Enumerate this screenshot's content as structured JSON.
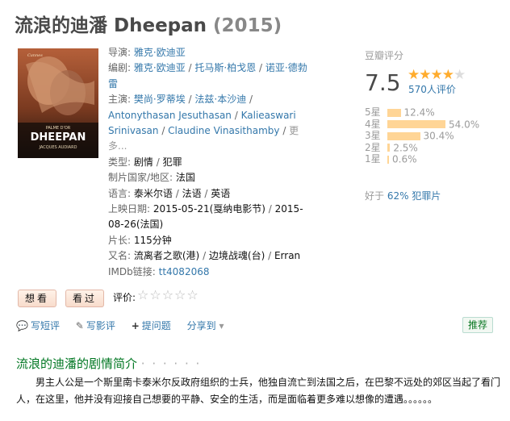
{
  "title": {
    "name": "流浪的迪潘 Dheepan",
    "year": "(2015)"
  },
  "poster": {
    "alt": "Dheepan poster",
    "text_top": "PALME D'OR",
    "text_main": "DHEEPAN",
    "text_dir": "JACQUES AUDIARD",
    "festival": "Cannes",
    "colors": {
      "bg": "#a34e2b",
      "skin": "#c98a64",
      "dark": "#2a1a12"
    }
  },
  "info": {
    "director_label": "导演:",
    "director": "雅克·欧迪亚",
    "writer_label": "编剧:",
    "writers": [
      "雅克·欧迪亚",
      "托马斯·柏戈恩",
      "诺亚·德勃雷"
    ],
    "cast_label": "主演:",
    "cast": [
      "樊尚·罗蒂埃",
      "法兹·本沙迪",
      "Antonythasan Jesuthasan",
      "Kalieaswari Srinivasan",
      "Claudine Vinasithamby"
    ],
    "cast_more": "更多...",
    "genre_label": "类型:",
    "genres": [
      "剧情",
      "犯罪"
    ],
    "country_label": "制片国家/地区:",
    "country": "法国",
    "language_label": "语言:",
    "languages": [
      "泰米尔语",
      "法语",
      "英语"
    ],
    "release_label": "上映日期:",
    "release_1": "2015-05-21(戛纳电影节)",
    "release_2": "2015-08-26(法国)",
    "runtime_label": "片长:",
    "runtime": "115分钟",
    "aka_label": "又名:",
    "aka": [
      "流离者之歌(港)",
      "边境战魂(台)",
      "Erran"
    ],
    "imdb_label": "IMDb链接:",
    "imdb": "tt4082068"
  },
  "rating": {
    "header": "豆瓣评分",
    "score": "7.5",
    "stars": 4,
    "stars_total": 5,
    "votes": "570人评价",
    "distribution": [
      {
        "label": "5星",
        "percent": 12.4,
        "text": "12.4%"
      },
      {
        "label": "4星",
        "percent": 54.0,
        "text": "54.0%"
      },
      {
        "label": "3星",
        "percent": 30.4,
        "text": "30.4%"
      },
      {
        "label": "2星",
        "percent": 2.5,
        "text": "2.5%"
      },
      {
        "label": "1星",
        "percent": 0.6,
        "text": "0.6%"
      }
    ],
    "better_prefix": "好于",
    "better_link": "62% 犯罪片",
    "colors": {
      "star": "#ffac2d",
      "bar": "#ffd596"
    }
  },
  "buttons": {
    "want": "想看",
    "seen": "看过",
    "rate_label": "评价:",
    "rate_stars": "☆☆☆☆☆"
  },
  "actions": {
    "short_review": "写短评",
    "review": "写影评",
    "ask": "提问题",
    "share": "分享到",
    "recommend": "推荐"
  },
  "summary": {
    "title": "流浪的迪潘的剧情简介",
    "dots": "· · · · · ·",
    "text": "男主人公是一个斯里南卡泰米尔反政府组织的士兵，他独自流亡到法国之后，在巴黎不远处的郊区当起了看门人，在这里，他并没有迎接自己想要的平静、安全的生活，而是面临着更多难以想像的遭遇。。。。。。"
  }
}
